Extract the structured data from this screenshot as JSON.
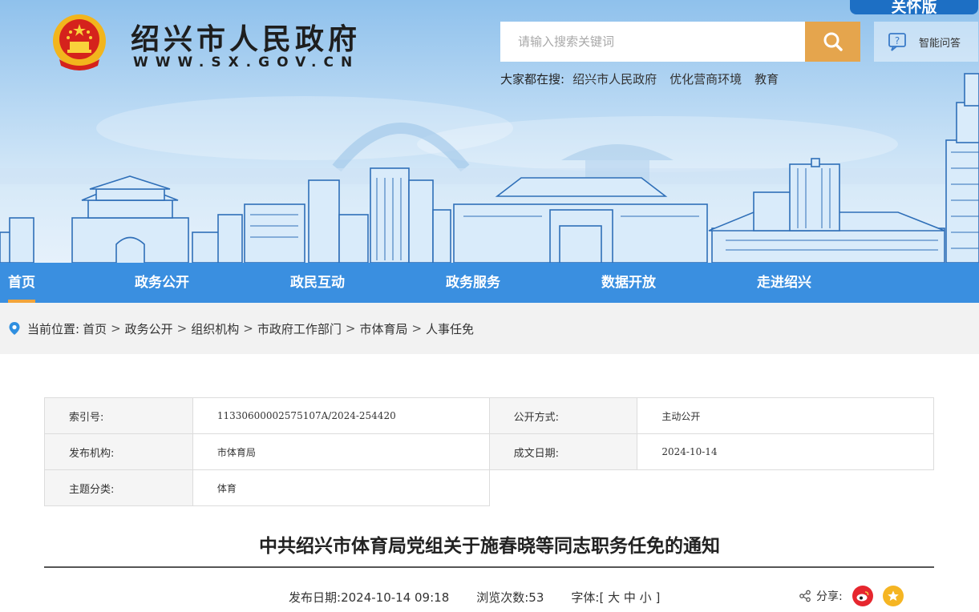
{
  "header": {
    "site_title": "绍兴市人民政府",
    "site_url": "WWW.SX.GOV.CN",
    "elder_tab": "关怀版",
    "search": {
      "placeholder": "请输入搜索关键词"
    },
    "smart_qa": "智能问答",
    "hot_search": {
      "label": "大家都在搜:",
      "items": [
        "绍兴市人民政府",
        "优化营商环境",
        "教育"
      ]
    }
  },
  "nav": {
    "items": [
      "首页",
      "政务公开",
      "政民互动",
      "政务服务",
      "数据开放",
      "走进绍兴"
    ],
    "active": "首页"
  },
  "breadcrumb": {
    "label": "当前位置:",
    "items": [
      "首页",
      "政务公开",
      "组织机构",
      "市政府工作部门",
      "市体育局",
      "人事任免"
    ],
    "separator": ">"
  },
  "meta": {
    "index_key": "索引号:",
    "index_value": "11330600002575107A/2024-254420",
    "open_key": "公开方式:",
    "open_value": "主动公开",
    "org_key": "发布机构:",
    "org_value": "市体育局",
    "date_key": "成文日期:",
    "date_value": "2024-10-14",
    "topic_key": "主题分类:",
    "topic_value": "体育"
  },
  "article": {
    "title": "中共绍兴市体育局党组关于施春晓等同志职务任免的通知",
    "publish_label": "发布日期:",
    "publish_value": "2024-10-14 09:18",
    "views_label": "浏览次数:",
    "views_value": "53",
    "font_label": "字体:[",
    "font_large": "大",
    "font_medium": "中",
    "font_small": "小",
    "font_close": "]",
    "share_label": "分享:"
  },
  "colors": {
    "nav_bg": "#3a8fe0",
    "nav_active_underline": "#f2a43b",
    "search_button": "#e5a54d",
    "elder_tab": "#1d6fc4",
    "weibo": "#e6262e",
    "favorite": "#f5b523"
  }
}
